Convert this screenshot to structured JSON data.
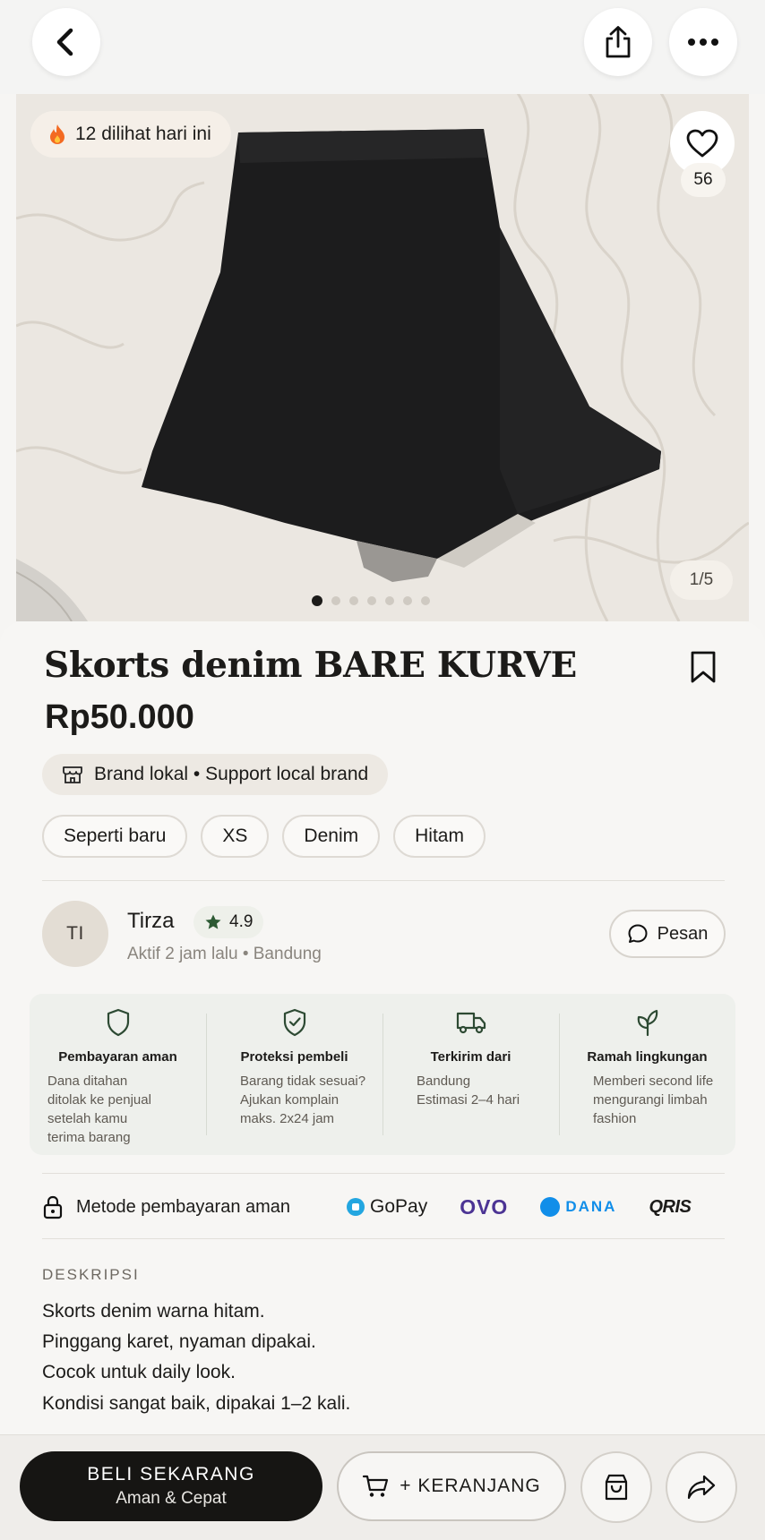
{
  "nav": {
    "back_icon": "chevron-left-icon",
    "share_icon": "share-icon",
    "more_icon": "more-horizontal-icon"
  },
  "gallery": {
    "views_text": "12 dilihat hari ini",
    "likes": "56",
    "counter": "1/5",
    "image_count": 7,
    "active_index": 0
  },
  "product": {
    "title": "Skorts denim BARE KURVE",
    "price": "Rp50.000",
    "brand_chip": "Brand lokal • Support local brand",
    "tags": [
      "Seperti baru",
      "XS",
      "Denim",
      "Hitam"
    ]
  },
  "seller": {
    "initials": "TI",
    "name": "Tirza",
    "rating": "4.9",
    "meta": "Aktif 2 jam lalu • Bandung",
    "message_label": "Pesan"
  },
  "trust": [
    {
      "icon": "shield-icon",
      "title": "Pembayaran aman",
      "body": "Dana ditahan\nditolak ke penjual\nsetelah kamu\nterima barang"
    },
    {
      "icon": "shield-check-icon",
      "title": "Proteksi pembeli",
      "body": "Barang tidak sesuai?\nAjukan komplain\nmaks. 2x24 jam"
    },
    {
      "icon": "truck-icon",
      "title": "Terkirim dari",
      "body": "Bandung\nEstimasi 2–4 hari"
    },
    {
      "icon": "leaf-icon",
      "title": "Ramah lingkungan",
      "body": "Memberi second life\nmengurangi limbah\nfashion"
    }
  ],
  "payment": {
    "label": "Metode pembayaran aman",
    "methods": [
      "GoPay",
      "OVO",
      "DANA",
      "QRIS"
    ]
  },
  "description": {
    "title": "DESKRIPSI",
    "lines": [
      "Skorts denim warna hitam.",
      "Pinggang karet, nyaman dipakai.",
      "Cocok untuk daily look.",
      "Kondisi sangat baik, dipakai 1–2 kali."
    ]
  },
  "actions": {
    "buy_label": "BELI SEKARANG",
    "buy_sub": "Aman & Cepat",
    "cart_label": "+ KERANJANG"
  },
  "colors": {
    "accent": "#161513",
    "background": "#f7f6f4",
    "trust_bg": "#eef0ec",
    "rating_star": "#2d5a34"
  }
}
